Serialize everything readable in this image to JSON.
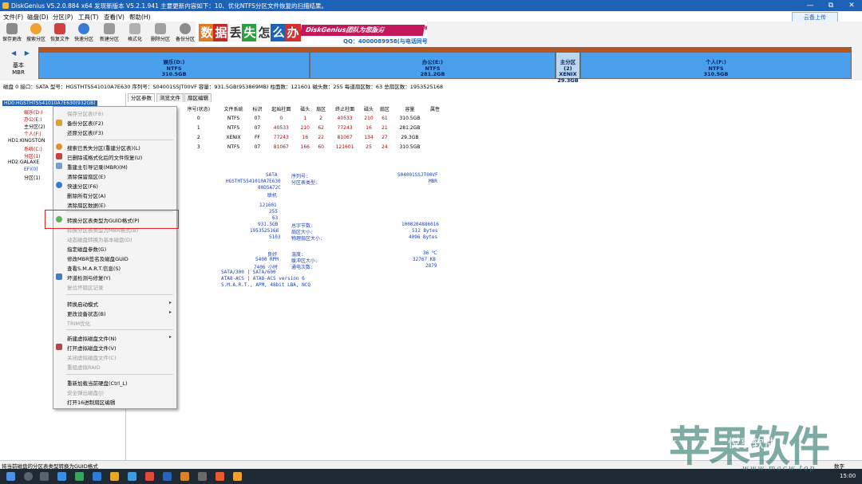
{
  "window": {
    "title": "DiskGenius V5.2.0.884 x64    发现新版本 V5.2.1.941 主要更新内容如下：10、优化NTFS分区文件恢复的扫描结果。",
    "controls": [
      "—",
      "⧉",
      "✕"
    ]
  },
  "menu": [
    "文件(F)",
    "磁盘(D)",
    "分区(P)",
    "工具(T)",
    "查看(V)",
    "帮助(H)"
  ],
  "cloud_button": "云备上传",
  "toolbar": [
    "保存更改",
    "搜索分区",
    "恢复文件",
    "快速分区",
    "新建分区",
    "格式化",
    "删除分区",
    "备份分区"
  ],
  "banner": {
    "chars": [
      "数",
      "据",
      "丢",
      "失",
      "怎",
      "么",
      "办"
    ],
    "slogan": "DiskGenius团队为您服务",
    "phone": "电话：400-008-9958",
    "qq": "QQ：4000089958(与电话同号)"
  },
  "disk_bar": {
    "nav": "◀ ▶",
    "basic_line1": "基本",
    "basic_line2": "MBR",
    "partitions": [
      {
        "name": "娱乐(D:)",
        "fs": "NTFS",
        "size": "310.5GB"
      },
      {
        "name": "办公(E:)",
        "fs": "NTFS",
        "size": "281.2GB"
      },
      {
        "name": "主分区(2)",
        "fs": "XENIX",
        "size": "29.3GB"
      },
      {
        "name": "个人(F:)",
        "fs": "NTFS",
        "size": "310.5GB"
      }
    ]
  },
  "disk_info": "磁盘 0 接口：SATA  型号：HGSTHTS541010A7E630  序列号：S04001SSJT00VF  容量：931.5GB(953869MB)  柱面数：121601  磁头数：255  每道扇区数：63  总扇区数：1953525168",
  "tree": [
    "HD0:HGSTHTS541010A7E630(932GB)",
    "娱乐(D:)",
    "办公(E:)",
    "主分区(2)",
    "个人(F:)",
    "HD1:KINGSTON",
    "系统(C:)",
    "分区(1)",
    "HD2:GALAXE",
    "EFI(0)",
    "分区(1)"
  ],
  "tabs": [
    "分区参数",
    "浏览文件",
    "扇区编辑"
  ],
  "partition_table": {
    "headers": [
      "序号(状态)",
      "文件系统",
      "标识",
      "起始柱面",
      "磁头",
      "扇区",
      "终止柱面",
      "磁头",
      "扇区",
      "容量",
      "属性"
    ],
    "rows": [
      [
        "0",
        "NTFS",
        "07",
        "0",
        "1",
        "2",
        "40533",
        "210",
        "61",
        "310.5GB",
        ""
      ],
      [
        "1",
        "NTFS",
        "07",
        "40533",
        "210",
        "62",
        "77243",
        "16",
        "21",
        "281.2GB",
        ""
      ],
      [
        "2",
        "XENIX",
        "FF",
        "77243",
        "16",
        "22",
        "81067",
        "134",
        "27",
        "29.3GB",
        ""
      ],
      [
        "3",
        "NTFS",
        "07",
        "81067",
        "166",
        "60",
        "121601",
        "25",
        "24",
        "310.5GB",
        ""
      ]
    ]
  },
  "details": {
    "iface_value": "SATA",
    "model_value": "HGSTHTS541010A7E630",
    "id_value": "80D5A72C",
    "state_value": "联机",
    "serial_label": "序列号:",
    "serial_value": "S04001SSJT00VF",
    "ptype_label": "分区表类型:",
    "ptype_value": "MBR",
    "cyl": "121601",
    "heads": "255",
    "sectors": "63",
    "capacity": "931.5GB",
    "total_sectors": "1953525168",
    "total_bytes_label": "总字节数:",
    "total_bytes_value": "1000204886016",
    "sector_size_label": "扇区大小:",
    "sector_size_value": "512 Bytes",
    "extra_sectors": "5103",
    "phys_sector_label": "物理扇区大小:",
    "phys_sector_value": "4096 Bytes",
    "health": "良好",
    "temp_label": "温度:",
    "temp_value": "36 ℃",
    "rpm": "5400 RPM",
    "cache_label": "缓冲区大小:",
    "cache_value": "32767 KB",
    "hours": "7406 小时",
    "power_label": "通电次数:",
    "power_value": "2879",
    "sata_mode": "SATA/300 | SATA/600",
    "ata_std": "ATA8-ACS | ATA8-ACS version 6",
    "features": "S.M.A.R.T., APM, 48bit LBA, NCQ"
  },
  "context_menu": [
    {
      "label": "保存分区表(F8)",
      "disabled": true
    },
    {
      "label": "备份分区表(F2)",
      "disabled": false
    },
    {
      "label": "还原分区表(F3)",
      "disabled": false
    },
    {
      "label": "搜索已丢失分区(重建分区表)(L)",
      "disabled": false
    },
    {
      "label": "已删除或格式化后的文件恢复(U)",
      "disabled": false
    },
    {
      "label": "重建主引导记录(MBR)(M)",
      "disabled": false
    },
    {
      "label": "清除保留扇区(E)",
      "disabled": false
    },
    {
      "label": "快速分区(F6)",
      "disabled": false
    },
    {
      "label": "删除所有分区(A)",
      "disabled": false
    },
    {
      "label": "清除扇区数据(E)",
      "disabled": false
    },
    {
      "label": "转换分区表类型为GUID格式(P)",
      "disabled": false
    },
    {
      "label": "转换分区表类型为MBR格式(B)",
      "disabled": true
    },
    {
      "label": "动态磁盘转换为基本磁盘(D)",
      "disabled": true
    },
    {
      "label": "指定磁盘参数(G)",
      "disabled": false
    },
    {
      "label": "修改MBR签名及磁盘GUID",
      "disabled": false
    },
    {
      "label": "查看S.M.A.R.T.信息(S)",
      "disabled": false
    },
    {
      "label": "坏道检测与修复(Y)",
      "disabled": false
    },
    {
      "label": "复位坏扇区记录",
      "disabled": true
    },
    {
      "label": "转换启动模式",
      "disabled": false
    },
    {
      "label": "更改设备状态(B)",
      "disabled": false
    },
    {
      "label": "TRIM优化",
      "disabled": true
    },
    {
      "label": "新建虚拟磁盘文件(N)",
      "disabled": false
    },
    {
      "label": "打开虚拟磁盘文件(V)",
      "disabled": false
    },
    {
      "label": "关闭虚拟磁盘文件(C)",
      "disabled": true
    },
    {
      "label": "重组虚拟RAID",
      "disabled": true
    },
    {
      "label": "重新加载当前硬盘(Ctrl_L)",
      "disabled": false
    },
    {
      "label": "安全弹出磁盘(J)",
      "disabled": true
    },
    {
      "label": "打开16进制扇区编辑",
      "disabled": false
    }
  ],
  "status_text": "将当前磁盘的分区表类型转换为GUID格式",
  "status_right": "数字",
  "clock": "15:00",
  "watermark": {
    "big": "苹果软件",
    "small": "悦享软件",
    "url": "www.macw.top"
  },
  "colors": {
    "titlebar": "#1c63b8",
    "partition_fill": "#4aa0ec",
    "partition_strip": "#b4541e",
    "highlight_box": "#e02222"
  }
}
